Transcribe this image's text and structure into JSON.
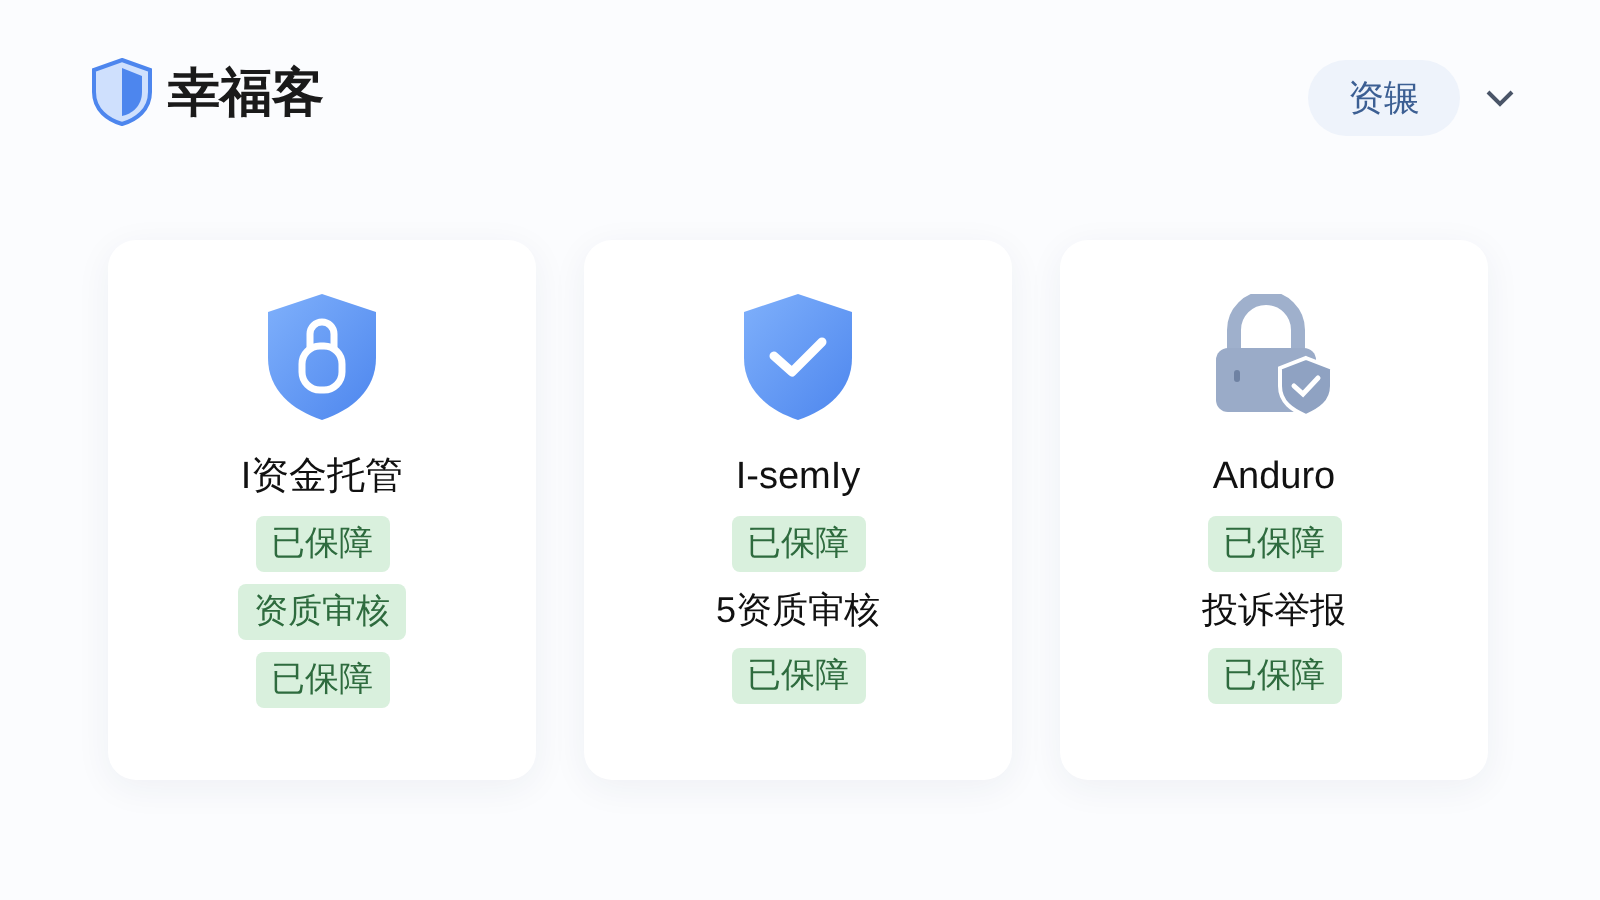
{
  "header": {
    "brand": "幸福客",
    "account_button": "资辗"
  },
  "cards": [
    {
      "kind": "shield-lock",
      "title": "I资金托管",
      "lines": [
        {
          "kind": "badge",
          "text": "已保障"
        },
        {
          "kind": "badge",
          "text": "资质审核"
        },
        {
          "kind": "badge",
          "text": "已保障"
        }
      ]
    },
    {
      "kind": "shield-check",
      "title": "I-semIy",
      "lines": [
        {
          "kind": "badge",
          "text": "已保障"
        },
        {
          "kind": "text",
          "text": "5资质审核"
        },
        {
          "kind": "badge",
          "text": "已保障"
        }
      ]
    },
    {
      "kind": "padlock",
      "title": "Anduro",
      "lines": [
        {
          "kind": "badge",
          "text": "已保障"
        },
        {
          "kind": "text",
          "text": "投诉举报"
        },
        {
          "kind": "badge",
          "text": "已保障"
        }
      ]
    }
  ]
}
